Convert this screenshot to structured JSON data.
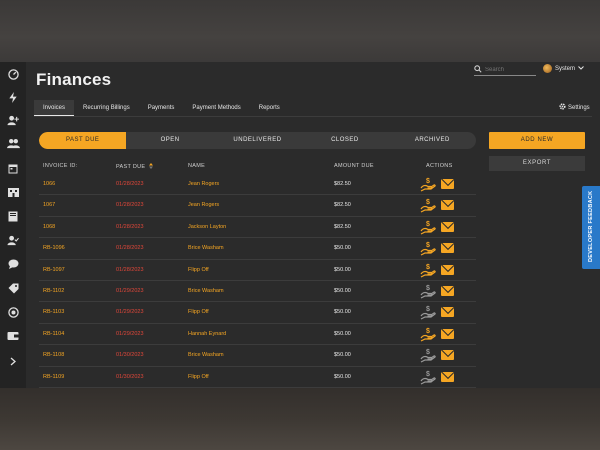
{
  "header": {
    "title": "Finances",
    "search_placeholder": "Search",
    "user_name": "System",
    "settings_label": "Settings"
  },
  "tabs": [
    {
      "label": "Invoices",
      "active": true
    },
    {
      "label": "Recurring Billings",
      "active": false
    },
    {
      "label": "Payments",
      "active": false
    },
    {
      "label": "Payment Methods",
      "active": false
    },
    {
      "label": "Reports",
      "active": false
    }
  ],
  "filters": [
    {
      "label": "PAST DUE",
      "active": true
    },
    {
      "label": "OPEN",
      "active": false
    },
    {
      "label": "UNDELIVERED",
      "active": false
    },
    {
      "label": "CLOSED",
      "active": false
    },
    {
      "label": "ARCHIVED",
      "active": false
    }
  ],
  "buttons": {
    "add_new": "ADD NEW",
    "export": "EXPORT",
    "feedback": "DEVELOPER FEEDBACK"
  },
  "table": {
    "columns": [
      "INVOICE ID:",
      "PAST DUE",
      "NAME",
      "AMOUNT DUE",
      "ACTIONS"
    ],
    "rows": [
      {
        "id": "1066",
        "due": "01/28/2023",
        "name": "Jean Rogers",
        "amount": "$82.50",
        "pay_enabled": true
      },
      {
        "id": "1067",
        "due": "01/28/2023",
        "name": "Jean Rogers",
        "amount": "$82.50",
        "pay_enabled": true
      },
      {
        "id": "1068",
        "due": "01/28/2023",
        "name": "Jackson Layton",
        "amount": "$82.50",
        "pay_enabled": true
      },
      {
        "id": "RB-1096",
        "due": "01/28/2023",
        "name": "Brice Washam",
        "amount": "$50.00",
        "pay_enabled": true
      },
      {
        "id": "RB-1097",
        "due": "01/28/2023",
        "name": "Flipp Off",
        "amount": "$50.00",
        "pay_enabled": true
      },
      {
        "id": "RB-1102",
        "due": "01/29/2023",
        "name": "Brice Washam",
        "amount": "$50.00",
        "pay_enabled": false
      },
      {
        "id": "RB-1103",
        "due": "01/29/2023",
        "name": "Flipp Off",
        "amount": "$50.00",
        "pay_enabled": false
      },
      {
        "id": "RB-1104",
        "due": "01/29/2023",
        "name": "Hannah Eynard",
        "amount": "$50.00",
        "pay_enabled": true
      },
      {
        "id": "RB-1108",
        "due": "01/30/2023",
        "name": "Brice Washam",
        "amount": "$50.00",
        "pay_enabled": false
      },
      {
        "id": "RB-1109",
        "due": "01/30/2023",
        "name": "Flipp Off",
        "amount": "$50.00",
        "pay_enabled": false
      }
    ]
  },
  "sidebar_icons": [
    "dashboard-icon",
    "lightning-icon",
    "add-user-icon",
    "users-icon",
    "calendar-icon",
    "building-icon",
    "book-icon",
    "user-check-icon",
    "chat-icon",
    "tag-icon",
    "target-icon",
    "wallet-icon",
    "chevron-right-icon"
  ],
  "colors": {
    "accent": "#f5a623",
    "overdue": "#e0473a",
    "feedback": "#2979c9"
  }
}
